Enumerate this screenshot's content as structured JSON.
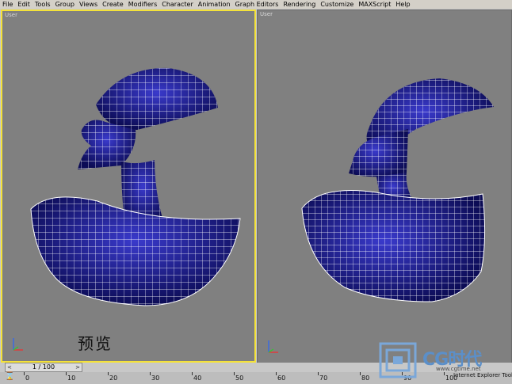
{
  "menu": [
    "File",
    "Edit",
    "Tools",
    "Group",
    "Views",
    "Create",
    "Modifiers",
    "Character",
    "Animation",
    "Graph Editors",
    "Rendering",
    "Customize",
    "MAXScript",
    "Help"
  ],
  "viewports": {
    "left_label": "User",
    "right_label": "User"
  },
  "overlay_text": "预览",
  "frame_counter": "1 / 100",
  "ruler_ticks": [
    "0",
    "10",
    "20",
    "30",
    "40",
    "50",
    "60",
    "70",
    "80",
    "90",
    "100"
  ],
  "logo": {
    "text": "CG时代",
    "url": "www.cgtime.net"
  },
  "status": "Internet Explorer Toolb",
  "colors": {
    "mesh_fill": "#1f1f9a",
    "wire": "#ffffff",
    "active_border": "#f4e23a",
    "viewport_bg": "#808080"
  }
}
